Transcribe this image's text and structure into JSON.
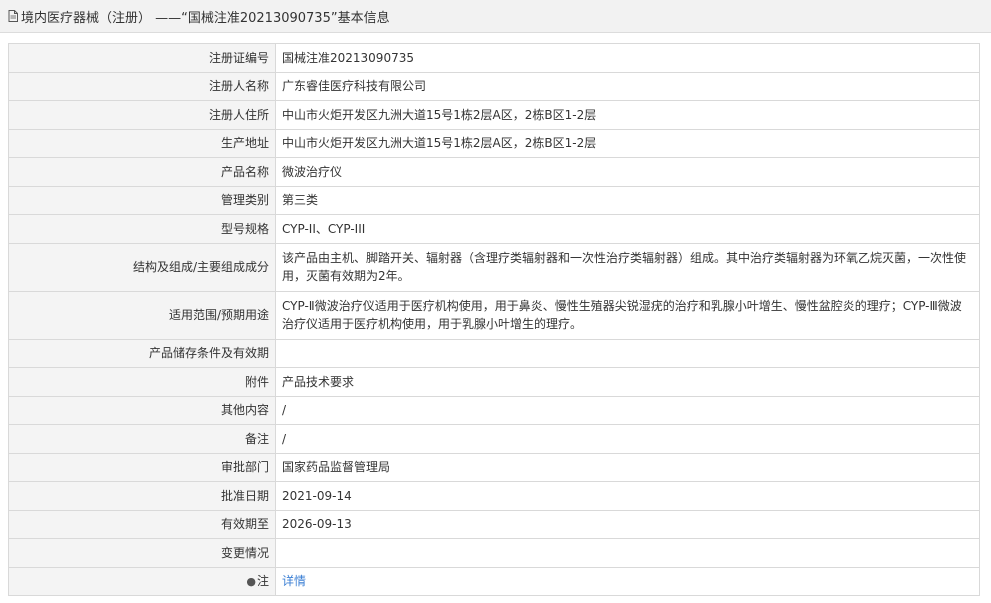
{
  "header": {
    "title": "境内医疗器械（注册） ——“国械注准20213090735”基本信息"
  },
  "rows": [
    {
      "label": "注册证编号",
      "value": "国械注准20213090735"
    },
    {
      "label": "注册人名称",
      "value": "广东睿佳医疗科技有限公司"
    },
    {
      "label": "注册人住所",
      "value": "中山市火炬开发区九洲大道15号1栋2层A区，2栋B区1-2层"
    },
    {
      "label": "生产地址",
      "value": "中山市火炬开发区九洲大道15号1栋2层A区，2栋B区1-2层"
    },
    {
      "label": "产品名称",
      "value": "微波治疗仪"
    },
    {
      "label": "管理类别",
      "value": "第三类"
    },
    {
      "label": "型号规格",
      "value": "CYP-II、CYP-III"
    },
    {
      "label": "结构及组成/主要组成成分",
      "value": "该产品由主机、脚踏开关、辐射器（含理疗类辐射器和一次性治疗类辐射器）组成。其中治疗类辐射器为环氧乙烷灭菌，一次性使用，灭菌有效期为2年。"
    },
    {
      "label": "适用范围/预期用途",
      "value": "CYP-Ⅱ微波治疗仪适用于医疗机构使用，用于鼻炎、慢性生殖器尖锐湿疣的治疗和乳腺小叶增生、慢性盆腔炎的理疗；CYP-Ⅲ微波治疗仪适用于医疗机构使用，用于乳腺小叶增生的理疗。"
    },
    {
      "label": "产品储存条件及有效期",
      "value": ""
    },
    {
      "label": "附件",
      "value": "产品技术要求"
    },
    {
      "label": "其他内容",
      "value": "/"
    },
    {
      "label": "备注",
      "value": "/"
    },
    {
      "label": "审批部门",
      "value": "国家药品监督管理局"
    },
    {
      "label": "批准日期",
      "value": "2021-09-14"
    },
    {
      "label": "有效期至",
      "value": "2026-09-13"
    },
    {
      "label": "变更情况",
      "value": ""
    }
  ],
  "note_row": {
    "icon": "lightbulb-icon",
    "label": "注",
    "link_text": "详情"
  },
  "colors": {
    "link": "#3b7fd4",
    "label_bg": "#f4f4f4",
    "border": "#d9d9d9"
  }
}
